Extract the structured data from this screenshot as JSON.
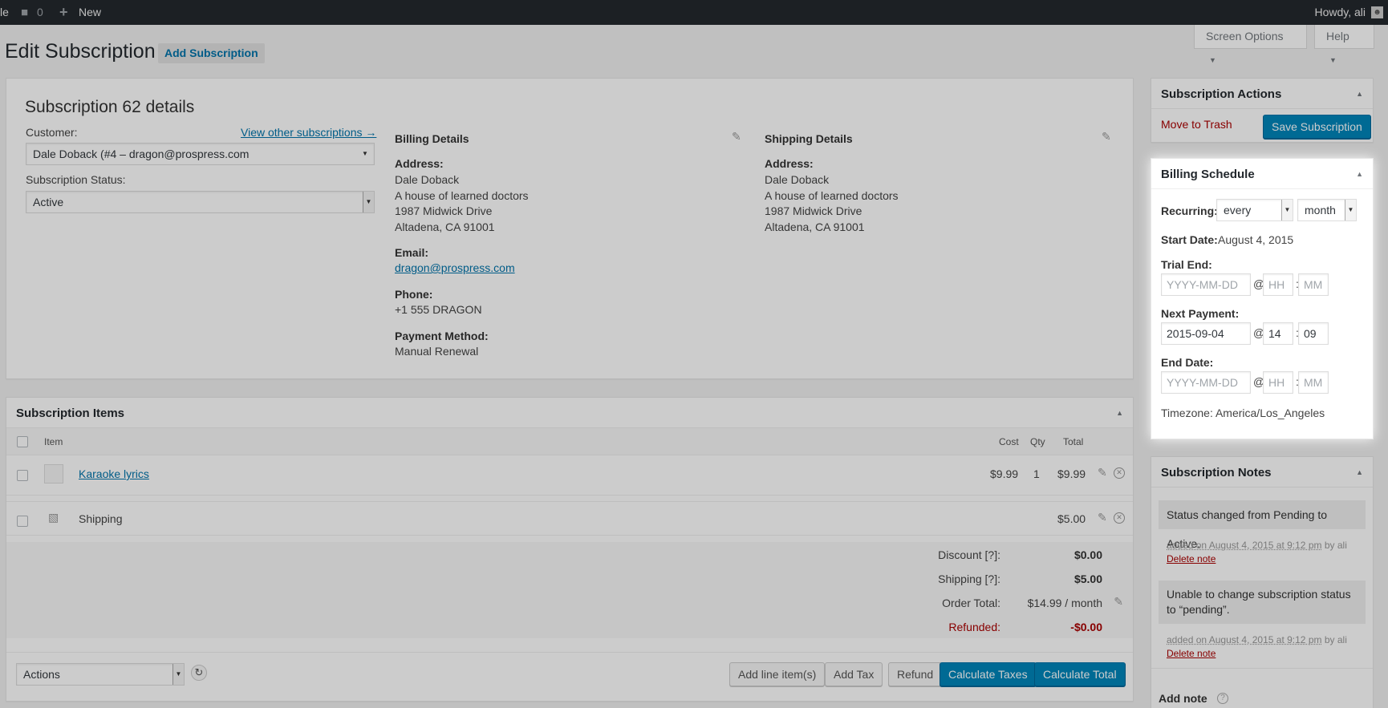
{
  "adminbar": {
    "site_fragment": "le",
    "comments_count": "0",
    "new_label": "New",
    "howdy": "Howdy, ali"
  },
  "header": {
    "title": "Edit Subscription",
    "add_button": "Add Subscription",
    "screen_options": "Screen Options",
    "help": "Help"
  },
  "details": {
    "title": "Subscription 62 details",
    "customer_label": "Customer:",
    "view_other": "View other subscriptions →",
    "customer_value": "Dale Doback (#4 – dragon@prospress.com",
    "status_label": "Subscription Status:",
    "status_value": "Active",
    "billing": {
      "heading": "Billing Details",
      "address_label": "Address:",
      "address_lines": [
        "Dale Doback",
        "A house of learned doctors",
        "1987 Midwick Drive",
        "Altadena, CA 91001"
      ],
      "email_label": "Email:",
      "email": "dragon@prospress.com",
      "phone_label": "Phone:",
      "phone": "+1 555 DRAGON",
      "payment_label": "Payment Method:",
      "payment": "Manual Renewal"
    },
    "shipping": {
      "heading": "Shipping Details",
      "address_label": "Address:",
      "address_lines": [
        "Dale Doback",
        "A house of learned doctors",
        "1987 Midwick Drive",
        "Altadena, CA 91001"
      ]
    }
  },
  "items": {
    "title": "Subscription Items",
    "col_item": "Item",
    "col_cost": "Cost",
    "col_qty": "Qty",
    "col_total": "Total",
    "row": {
      "name": "Karaoke lyrics",
      "cost": "$9.99",
      "qty": "1",
      "total": "$9.99"
    },
    "shipping_row": {
      "name": "Shipping",
      "total": "$5.00"
    },
    "totals": {
      "discount_label": "Discount [?]:",
      "discount": "$0.00",
      "shipping_label": "Shipping [?]:",
      "shipping": "$5.00",
      "order_total_label": "Order Total:",
      "order_total": "$14.99 / month",
      "refunded_label": "Refunded:",
      "refunded": "-$0.00"
    },
    "actions_select": "Actions",
    "buttons": {
      "add_line": "Add line item(s)",
      "add_tax": "Add Tax",
      "refund": "Refund",
      "calc_taxes": "Calculate Taxes",
      "calc_total": "Calculate Total"
    }
  },
  "actions_box": {
    "title": "Subscription Actions",
    "trash": "Move to Trash",
    "save": "Save Subscription"
  },
  "schedule": {
    "title": "Billing Schedule",
    "recurring_label": "Recurring:",
    "interval": "every",
    "period": "month",
    "start_label": "Start Date:",
    "start_value": "August 4, 2015",
    "trial_label": "Trial End:",
    "next_label": "Next Payment:",
    "next_date": "2015-09-04",
    "next_hh": "14",
    "next_mm": "09",
    "end_label": "End Date:",
    "date_placeholder": "YYYY-MM-DD",
    "hh_placeholder": "HH",
    "mm_placeholder": "MM",
    "at": "@",
    "colon": ":",
    "timezone": "Timezone: America/Los_Angeles"
  },
  "notes": {
    "title": "Subscription Notes",
    "list": [
      {
        "text": "Status changed from Pending to Active.",
        "meta": "added on August 4, 2015 at 9:12 pm",
        "by": "by ali",
        "delete": "Delete note"
      },
      {
        "text": "Unable to change subscription status to “pending”.",
        "meta": "added on August 4, 2015 at 9:12 pm",
        "by": "by ali",
        "delete": "Delete note"
      }
    ],
    "add_note": "Add note"
  }
}
